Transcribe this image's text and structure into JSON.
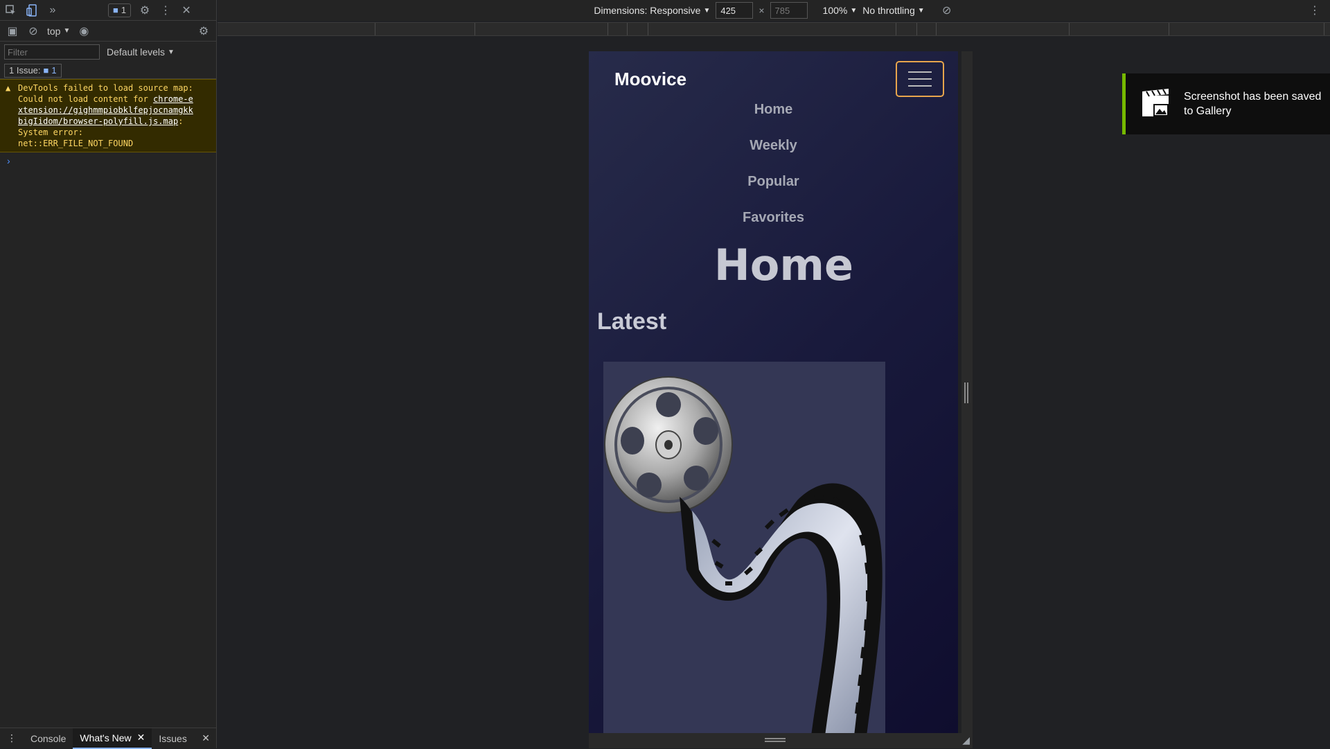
{
  "devtools": {
    "messages_badge": "1",
    "context": "top",
    "filter_placeholder": "Filter",
    "levels": "Default levels",
    "issues_label": "1 Issue:",
    "issues_count": "1",
    "warning": {
      "line1": "DevTools failed to load source map:",
      "line2a": "Could not load content for ",
      "link1": "chrome-e",
      "link2": "xtension://gighmmpiobklfepjocnamgkk",
      "link3": "bigIidom/browser-polyfill.js.map",
      "line_after_link": ":",
      "line4": "System error:",
      "line5": "net::ERR_FILE_NOT_FOUND"
    },
    "tabs": [
      "Console",
      "What's New",
      "Issues"
    ]
  },
  "device_toolbar": {
    "dimensions_label": "Dimensions: Responsive",
    "width": "425",
    "height": "785",
    "times": "×",
    "zoom": "100%",
    "throttling": "No throttling"
  },
  "site": {
    "brand": "Moovice",
    "nav": [
      "Home",
      "Weekly",
      "Popular",
      "Favorites"
    ],
    "page_title": "Home",
    "section_title": "Latest"
  },
  "toast": {
    "message": "Screenshot has been saved to Gallery"
  }
}
